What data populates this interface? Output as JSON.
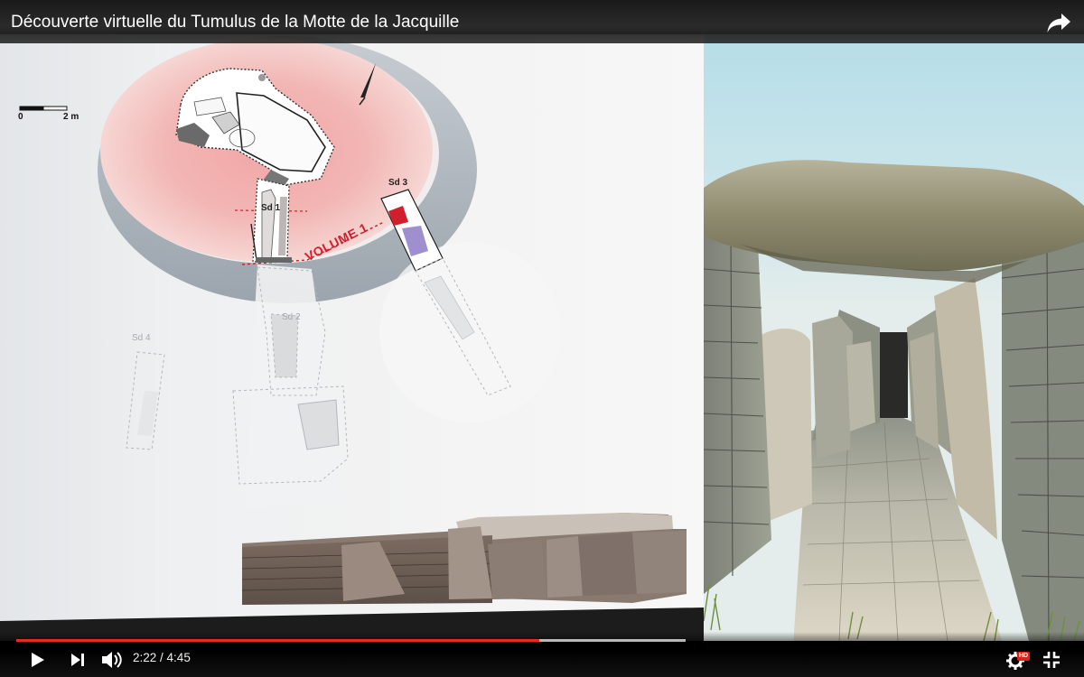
{
  "video": {
    "title": "Découverte virtuelle du Tumulus de la Motte de la Jacquille",
    "share_icon": "share-arrow-icon"
  },
  "plan": {
    "scale_zero": "0",
    "scale_two": "2 m",
    "volume_label": "VOLUME 1",
    "sondages": {
      "sd1": "Sd 1",
      "sd2": "Sd 2",
      "sd3": "Sd 3",
      "sd4": "Sd 4"
    }
  },
  "player": {
    "current_time": "2:22",
    "separator": " / ",
    "duration": "4:45",
    "progress_played": 0.782,
    "progress_loaded": 1.0,
    "hd_badge": "HD",
    "icons": {
      "play": "play-icon",
      "next": "next-icon",
      "volume": "volume-icon",
      "settings": "gear-icon",
      "fullscreen": "exit-fullscreen-icon"
    },
    "colors": {
      "played": "#e52b20",
      "hd": "#d8231a"
    }
  }
}
